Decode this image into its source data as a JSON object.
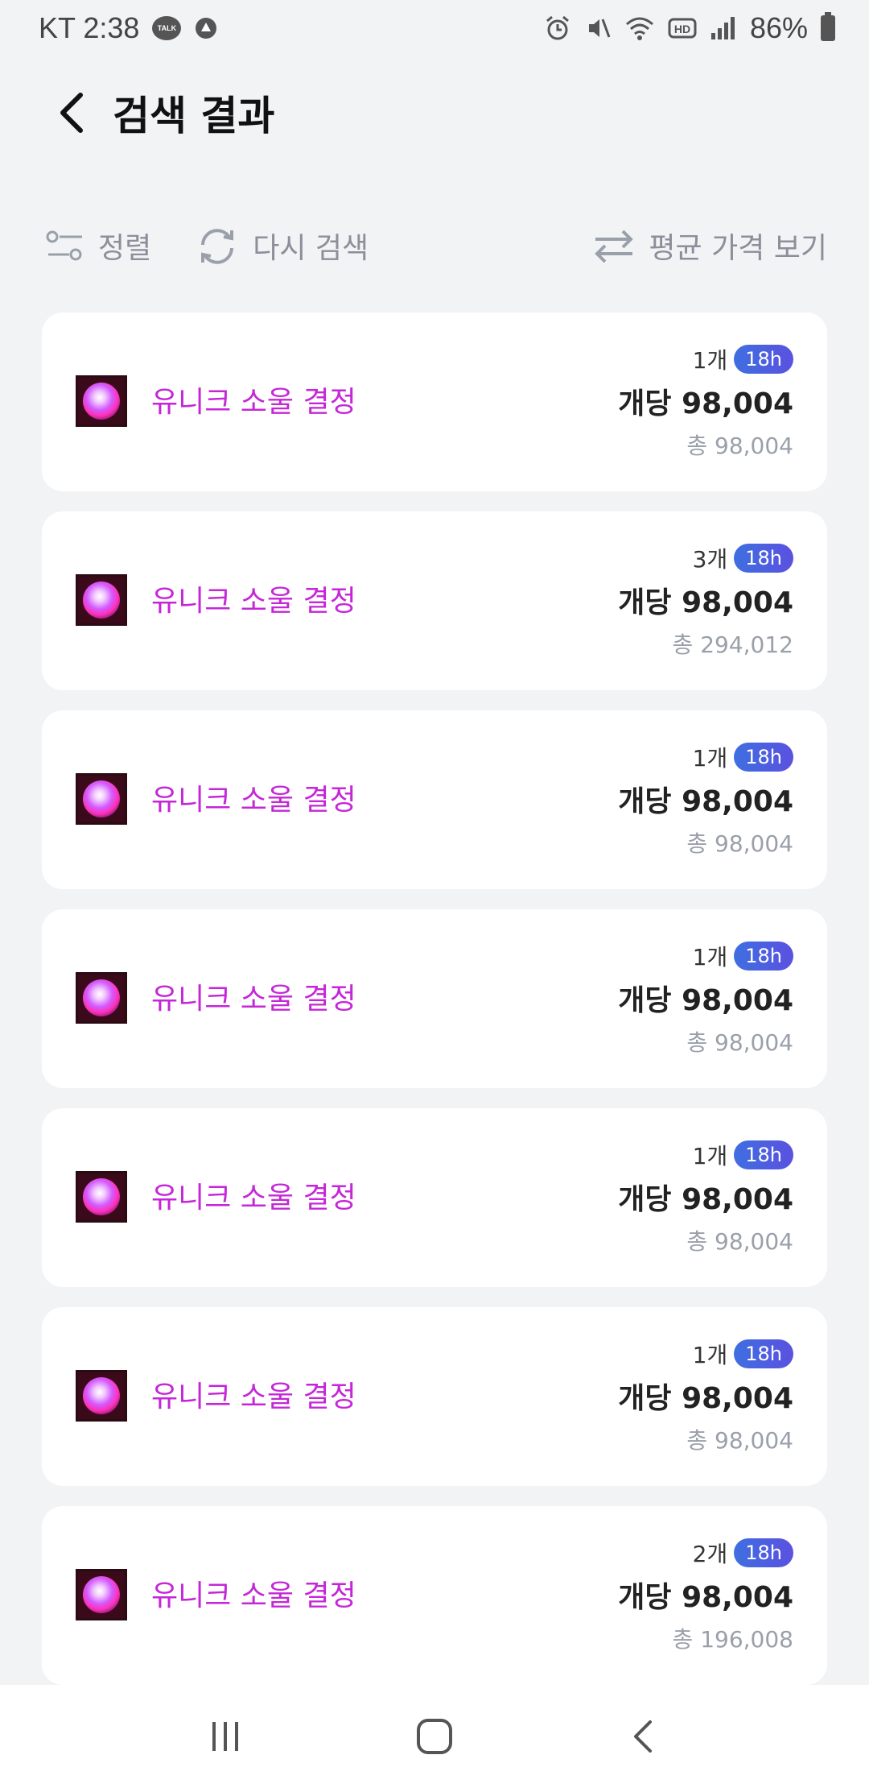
{
  "status_bar": {
    "carrier_time": "KT 2:38",
    "talk_icon_text": "TALK",
    "battery_percent": "86%"
  },
  "header": {
    "title": "검색 결과"
  },
  "toolbar": {
    "sort_label": "정렬",
    "research_label": "다시 검색",
    "avg_price_label": "평균 가격 보기"
  },
  "items": [
    {
      "name": "유니크 소울 결정",
      "quantity": "1개",
      "time_badge": "18h",
      "unit_price": "개당 98,004",
      "total": "총 98,004"
    },
    {
      "name": "유니크 소울 결정",
      "quantity": "3개",
      "time_badge": "18h",
      "unit_price": "개당 98,004",
      "total": "총 294,012"
    },
    {
      "name": "유니크 소울 결정",
      "quantity": "1개",
      "time_badge": "18h",
      "unit_price": "개당 98,004",
      "total": "총 98,004"
    },
    {
      "name": "유니크 소울 결정",
      "quantity": "1개",
      "time_badge": "18h",
      "unit_price": "개당 98,004",
      "total": "총 98,004"
    },
    {
      "name": "유니크 소울 결정",
      "quantity": "1개",
      "time_badge": "18h",
      "unit_price": "개당 98,004",
      "total": "총 98,004"
    },
    {
      "name": "유니크 소울 결정",
      "quantity": "1개",
      "time_badge": "18h",
      "unit_price": "개당 98,004",
      "total": "총 98,004"
    },
    {
      "name": "유니크 소울 결정",
      "quantity": "2개",
      "time_badge": "18h",
      "unit_price": "개당 98,004",
      "total": "총 196,008"
    }
  ],
  "colors": {
    "item_name": "#c526d8",
    "badge_start": "#3e6fe0",
    "badge_end": "#5b51e0",
    "background": "#f2f3f5"
  },
  "icons": {
    "back": "chevron-left-icon",
    "sort": "sort-icon",
    "refresh": "refresh-icon",
    "swap": "swap-arrows-icon",
    "nav_recent": "recent-apps-icon",
    "nav_home": "home-icon",
    "nav_back": "back-icon"
  }
}
